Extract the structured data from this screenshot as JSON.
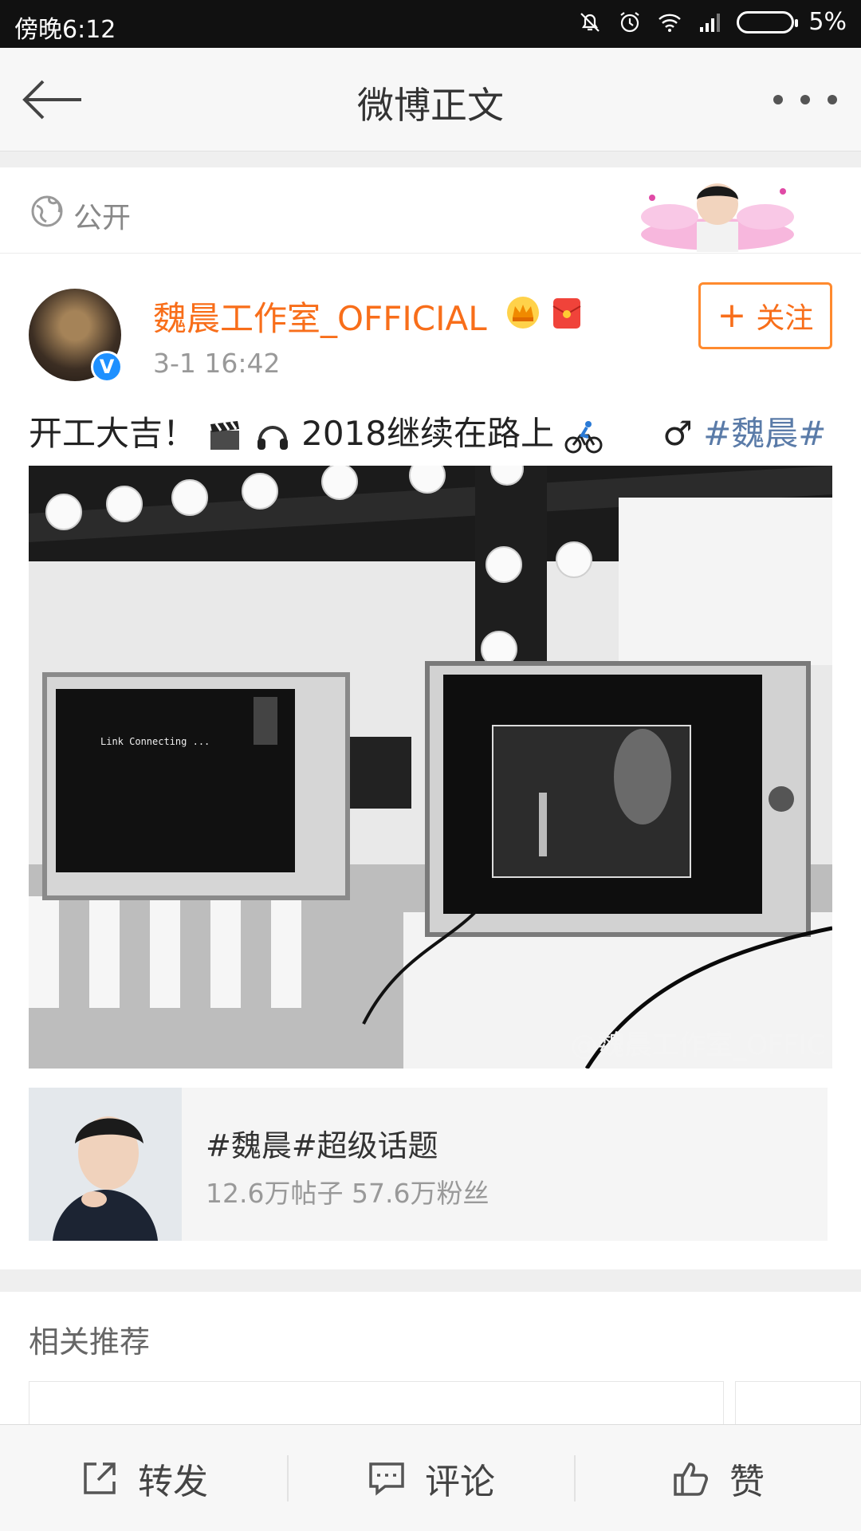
{
  "status_bar": {
    "time": "傍晚6:12",
    "battery": "5%",
    "icons": [
      "bell-off-icon",
      "alarm-icon",
      "wifi-icon",
      "signal-icon",
      "battery-icon"
    ]
  },
  "nav": {
    "title": "微博正文",
    "back_icon": "back-arrow-icon",
    "more_icon": "more-dots-icon"
  },
  "visibility": {
    "label": "公开",
    "icon": "globe-icon"
  },
  "post": {
    "author": "魏晨工作室_OFFICIAL",
    "time": "3-1 16:42",
    "follow_label": "关注",
    "text_start": "开工大吉！",
    "text_middle": "2018继续在路上",
    "text_end": "♂",
    "topic": "#魏晨#",
    "image_watermark": "@魏晨工作室_OFFIC"
  },
  "topic_card": {
    "title": "#魏晨#超级话题",
    "stats": "12.6万帖子 57.6万粉丝"
  },
  "recommend": {
    "section_title": "相关推荐"
  },
  "bottom_bar": {
    "repost": "转发",
    "comment": "评论",
    "like": "赞"
  },
  "colors": {
    "brand_orange": "#f86e1a",
    "topic_blue": "#5a7ba8",
    "verified_blue": "#1e90ff"
  }
}
